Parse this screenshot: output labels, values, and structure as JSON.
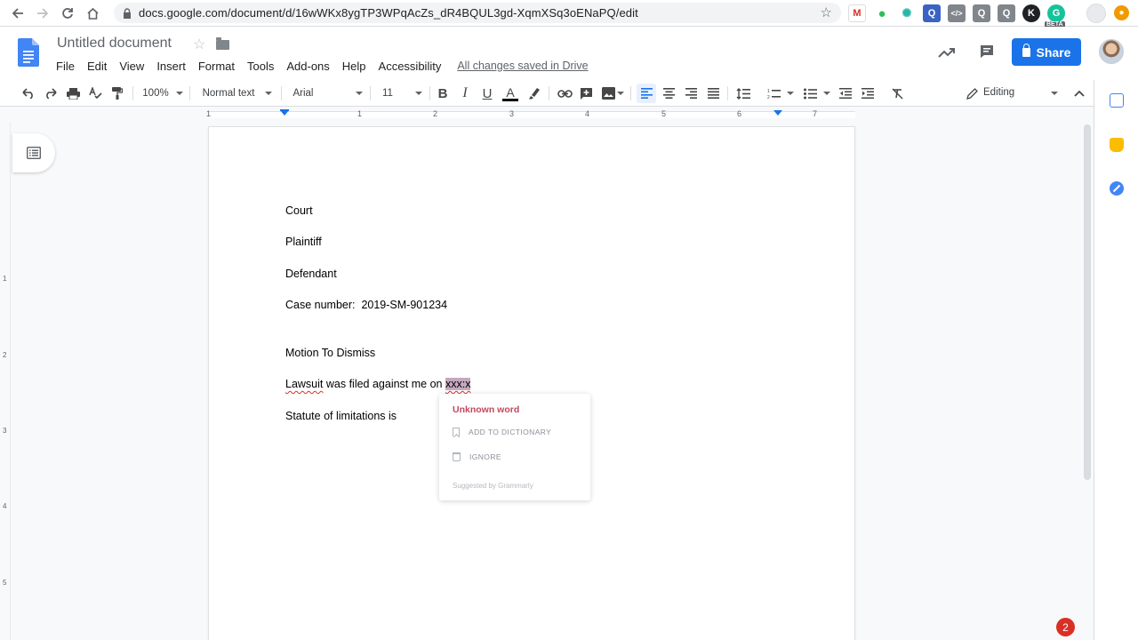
{
  "browser": {
    "url": "docs.google.com/document/d/16wWKx8ygTP3WPqAcZs_dR4BQUL3gd-XqmXSq3oENaPQ/edit",
    "ext_beta_label": "BETA"
  },
  "header": {
    "doc_title": "Untitled document",
    "menu": [
      "File",
      "Edit",
      "View",
      "Insert",
      "Format",
      "Tools",
      "Add-ons",
      "Help",
      "Accessibility"
    ],
    "saved_status": "All changes saved in Drive",
    "share_label": "Share"
  },
  "toolbar": {
    "zoom": "100%",
    "style": "Normal text",
    "font": "Arial",
    "font_size": "11",
    "mode": "Editing"
  },
  "ruler": {
    "numbers": [
      "1",
      "1",
      "2",
      "3",
      "4",
      "5",
      "6",
      "7"
    ]
  },
  "document": {
    "lines": [
      "Court",
      "Plaintiff",
      "Defendant",
      "Case number:  2019-SM-901234",
      "Motion To Dismiss"
    ],
    "lawsuit_word": "Lawsuit",
    "lawsuit_rest": " was filed against me on ",
    "highlighted_word": "xxx:x",
    "last_line": "Statute of limitations is"
  },
  "popup": {
    "title": "Unknown word",
    "add_label": "ADD TO DICTIONARY",
    "ignore_label": "IGNORE",
    "footer": "Suggested by Grammarly"
  },
  "notifications": {
    "count": "2"
  },
  "colors": {
    "accent": "#1a73e8",
    "error": "#d93025",
    "popup_title": "#c2485e",
    "selection": "#c5a8c0"
  }
}
